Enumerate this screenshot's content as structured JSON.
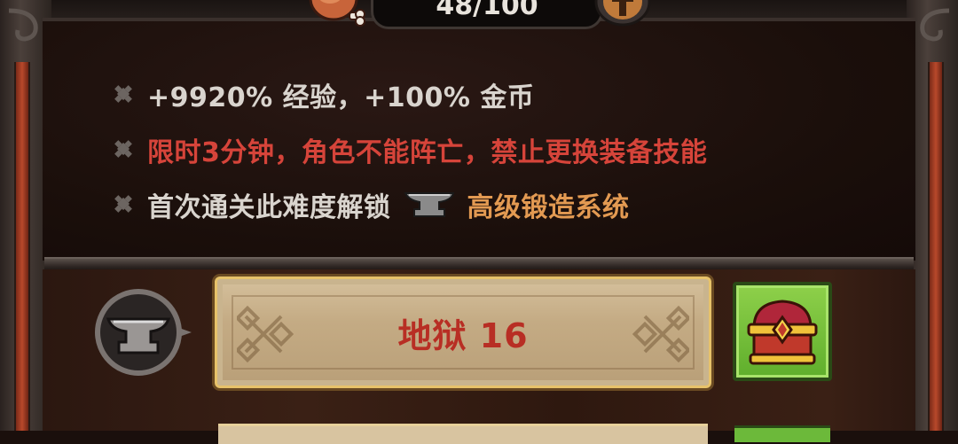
{
  "header": {
    "counter_text": "48/100",
    "meat_icon": "meat-icon",
    "cross_icon": "cross-shield-icon"
  },
  "info": {
    "line1": "+9920% 经验，+100% 金币",
    "line2": "限时3分钟，角色不能阵亡，禁止更换装备技能",
    "line3_prefix": "首次通关此难度解锁",
    "line3_icon": "anvil-icon",
    "line3_suffix": "高级锻造系统"
  },
  "difficulty": {
    "label": "地狱 16",
    "badge_icon": "anvil-icon",
    "reward_icon": "treasure-chest-icon"
  },
  "colors": {
    "light_text": "#d9d4ce",
    "warning_red": "#d6443a",
    "unlock_orange": "#e39a52",
    "difficulty_red": "#b82e24",
    "chest_green": "#6cb93a"
  }
}
